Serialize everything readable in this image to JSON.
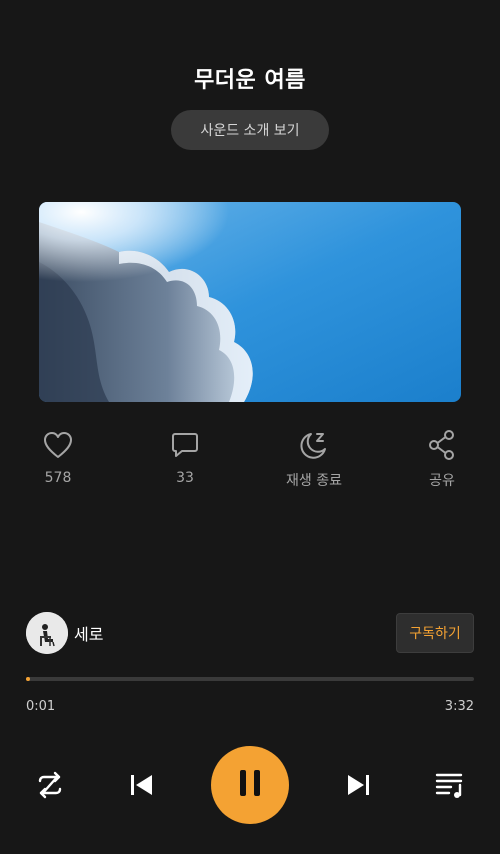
{
  "track": {
    "title": "무더운 여름",
    "intro_button": "사운드 소개 보기"
  },
  "actions": {
    "like_count": "578",
    "comment_count": "33",
    "sleep_timer_label": "재생 종료",
    "share_label": "공유"
  },
  "artist": {
    "name": "세로",
    "subscribe_label": "구독하기"
  },
  "playback": {
    "elapsed": "0:01",
    "total": "3:32",
    "progress_fraction": 0.005
  },
  "player_controls": [
    "repeat-icon",
    "previous-icon",
    "pause-icon",
    "next-icon",
    "playlist-icon"
  ],
  "colors": {
    "background": "#171717",
    "accent": "#f4a233",
    "muted_text": "#a5a5a5"
  }
}
